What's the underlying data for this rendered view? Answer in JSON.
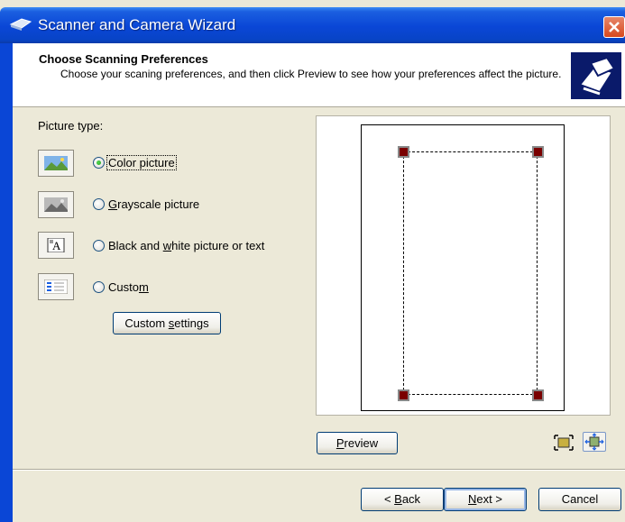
{
  "window": {
    "title": "Scanner and Camera Wizard"
  },
  "header": {
    "title": "Choose Scanning Preferences",
    "subtitle": "Choose your scaning preferences, and then click Preview to see how your preferences affect the picture."
  },
  "picture_type": {
    "label": "Picture type:",
    "options": [
      {
        "label": "Color picture",
        "selected": true,
        "icon": "color-photo-icon"
      },
      {
        "label_pre": "",
        "accel": "G",
        "label_post": "rayscale picture",
        "selected": false,
        "icon": "grayscale-photo-icon"
      },
      {
        "label_pre": "Black and ",
        "accel": "w",
        "label_post": "hite picture or text",
        "selected": false,
        "icon": "bw-text-icon"
      },
      {
        "label_pre": "Custo",
        "accel": "m",
        "label_post": "",
        "selected": false,
        "icon": "custom-settings-icon"
      }
    ]
  },
  "custom_settings": {
    "pre": "Custom ",
    "accel": "s",
    "post": "ettings"
  },
  "preview": {
    "accel": "P",
    "rest": "review"
  },
  "footer": {
    "back": {
      "pre": "< ",
      "accel": "B",
      "post": "ack"
    },
    "next": {
      "pre": "",
      "accel": "N",
      "post": "ext >"
    },
    "cancel": "Cancel"
  },
  "colors": {
    "titlebar": "#0a46d6",
    "face": "#ece9d8",
    "handle": "#7a0000"
  }
}
